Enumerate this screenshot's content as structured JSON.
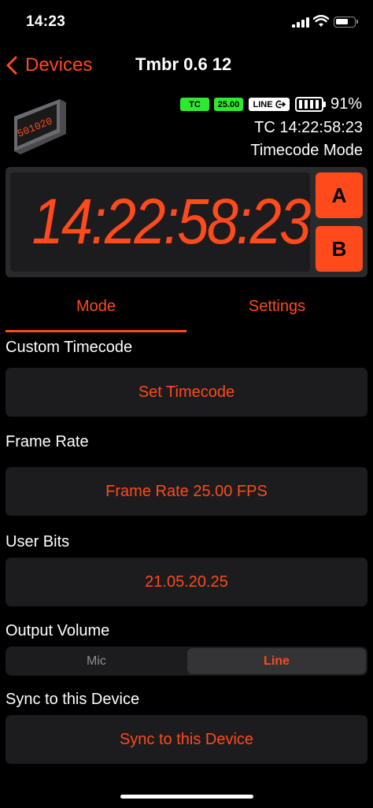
{
  "status_bar": {
    "time": "14:23"
  },
  "nav": {
    "back_label": "Devices",
    "title": "Tmbr 0.6 12"
  },
  "device": {
    "thumb_text": "501020",
    "tc_badge": "TC",
    "fps_badge": "25.00",
    "line_badge": "LINE",
    "battery_percent": "91%",
    "timecode_readout": "TC 14:22:58:23",
    "mode_readout": "Timecode Mode"
  },
  "display": {
    "timecode": "14:22:58:23",
    "a_label": "A",
    "b_label": "B"
  },
  "tabs": {
    "mode": "Mode",
    "settings": "Settings"
  },
  "sections": {
    "custom_timecode": {
      "label": "Custom Timecode",
      "button": "Set Timecode"
    },
    "frame_rate": {
      "label": "Frame Rate",
      "button": "Frame Rate 25.00 FPS"
    },
    "user_bits": {
      "label": "User Bits",
      "button": "21.05.20.25"
    },
    "output_volume": {
      "label": "Output Volume",
      "options": [
        "Mic",
        "Line"
      ],
      "selected": "Line"
    },
    "sync": {
      "label": "Sync to this Device",
      "button": "Sync to this Device"
    }
  },
  "colors": {
    "accent": "#ff4a1c",
    "badge_green": "#2eea2e",
    "panel": "#1c1c1e",
    "background": "#000000"
  }
}
